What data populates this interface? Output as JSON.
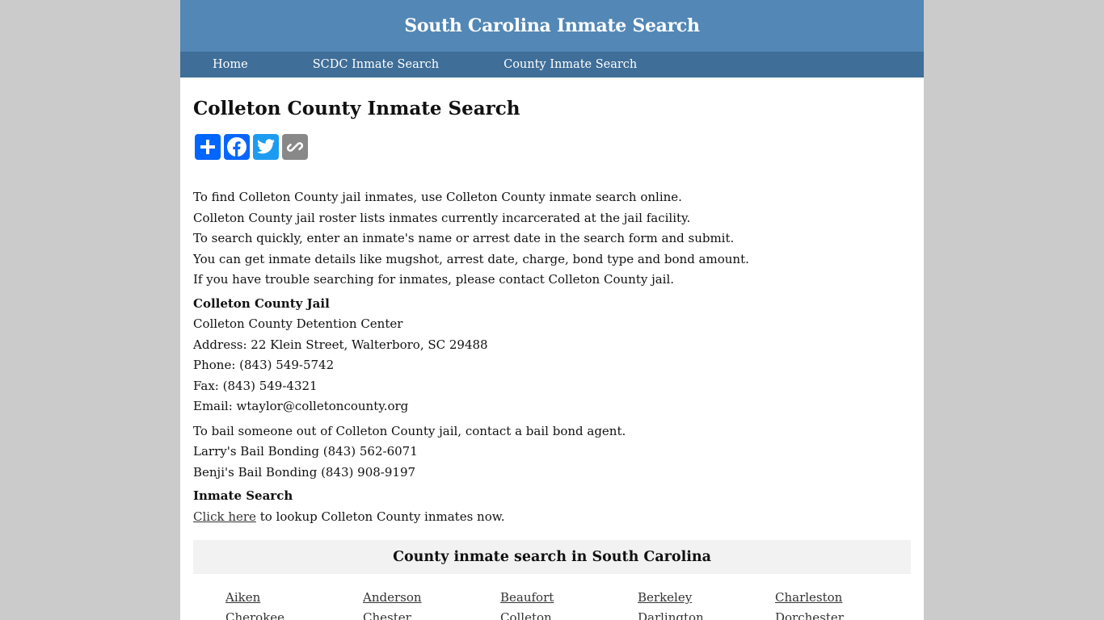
{
  "header": {
    "site_title": "South Carolina Inmate Search"
  },
  "nav": {
    "items": [
      {
        "label": "Home"
      },
      {
        "label": "SCDC Inmate Search"
      },
      {
        "label": "County Inmate Search"
      }
    ]
  },
  "main": {
    "title": "Colleton County Inmate Search",
    "share_buttons": [
      {
        "icon": "plus-share-icon",
        "label": "Share",
        "color": "#0166ff"
      },
      {
        "icon": "facebook-icon",
        "label": "Facebook",
        "color": "#0866ff"
      },
      {
        "icon": "twitter-icon",
        "label": "Twitter",
        "color": "#1d9bf0"
      },
      {
        "icon": "copy-link-icon",
        "label": "Copy Link",
        "color": "#888888"
      }
    ],
    "intro": [
      "To find Colleton County jail inmates, use Colleton County inmate search online.",
      "Colleton County jail roster lists inmates currently incarcerated at the jail facility.",
      "To search quickly, enter an inmate's name or arrest date in the search form and submit.",
      "You can get inmate details like mugshot, arrest date, charge, bond type and bond amount.",
      "If you have trouble searching for inmates, please contact Colleton County jail."
    ],
    "jail": {
      "heading": "Colleton County Jail",
      "name": "Colleton County Detention Center",
      "address": "Address: 22 Klein Street, Walterboro, SC 29488",
      "phone": "Phone: (843) 549-5742",
      "fax": "Fax: (843) 549-4321",
      "email": "Email: wtaylor@colletoncounty.org"
    },
    "bail": {
      "intro": "To bail someone out of Colleton County jail, contact a bail bond agent.",
      "agents": [
        "Larry's Bail Bonding (843) 562-6071",
        "Benji's Bail Bonding (843) 908-9197"
      ]
    },
    "inmate_search": {
      "heading": "Inmate Search",
      "link_text": "Click here",
      "rest_text": " to lookup Colleton County inmates now."
    },
    "county_section": {
      "heading": "County inmate search in South Carolina",
      "counties": [
        "Aiken",
        "Anderson",
        "Beaufort",
        "Berkeley",
        "Charleston",
        "Cherokee",
        "Chester",
        "Colleton",
        "Darlington",
        "Dorchester"
      ]
    }
  }
}
